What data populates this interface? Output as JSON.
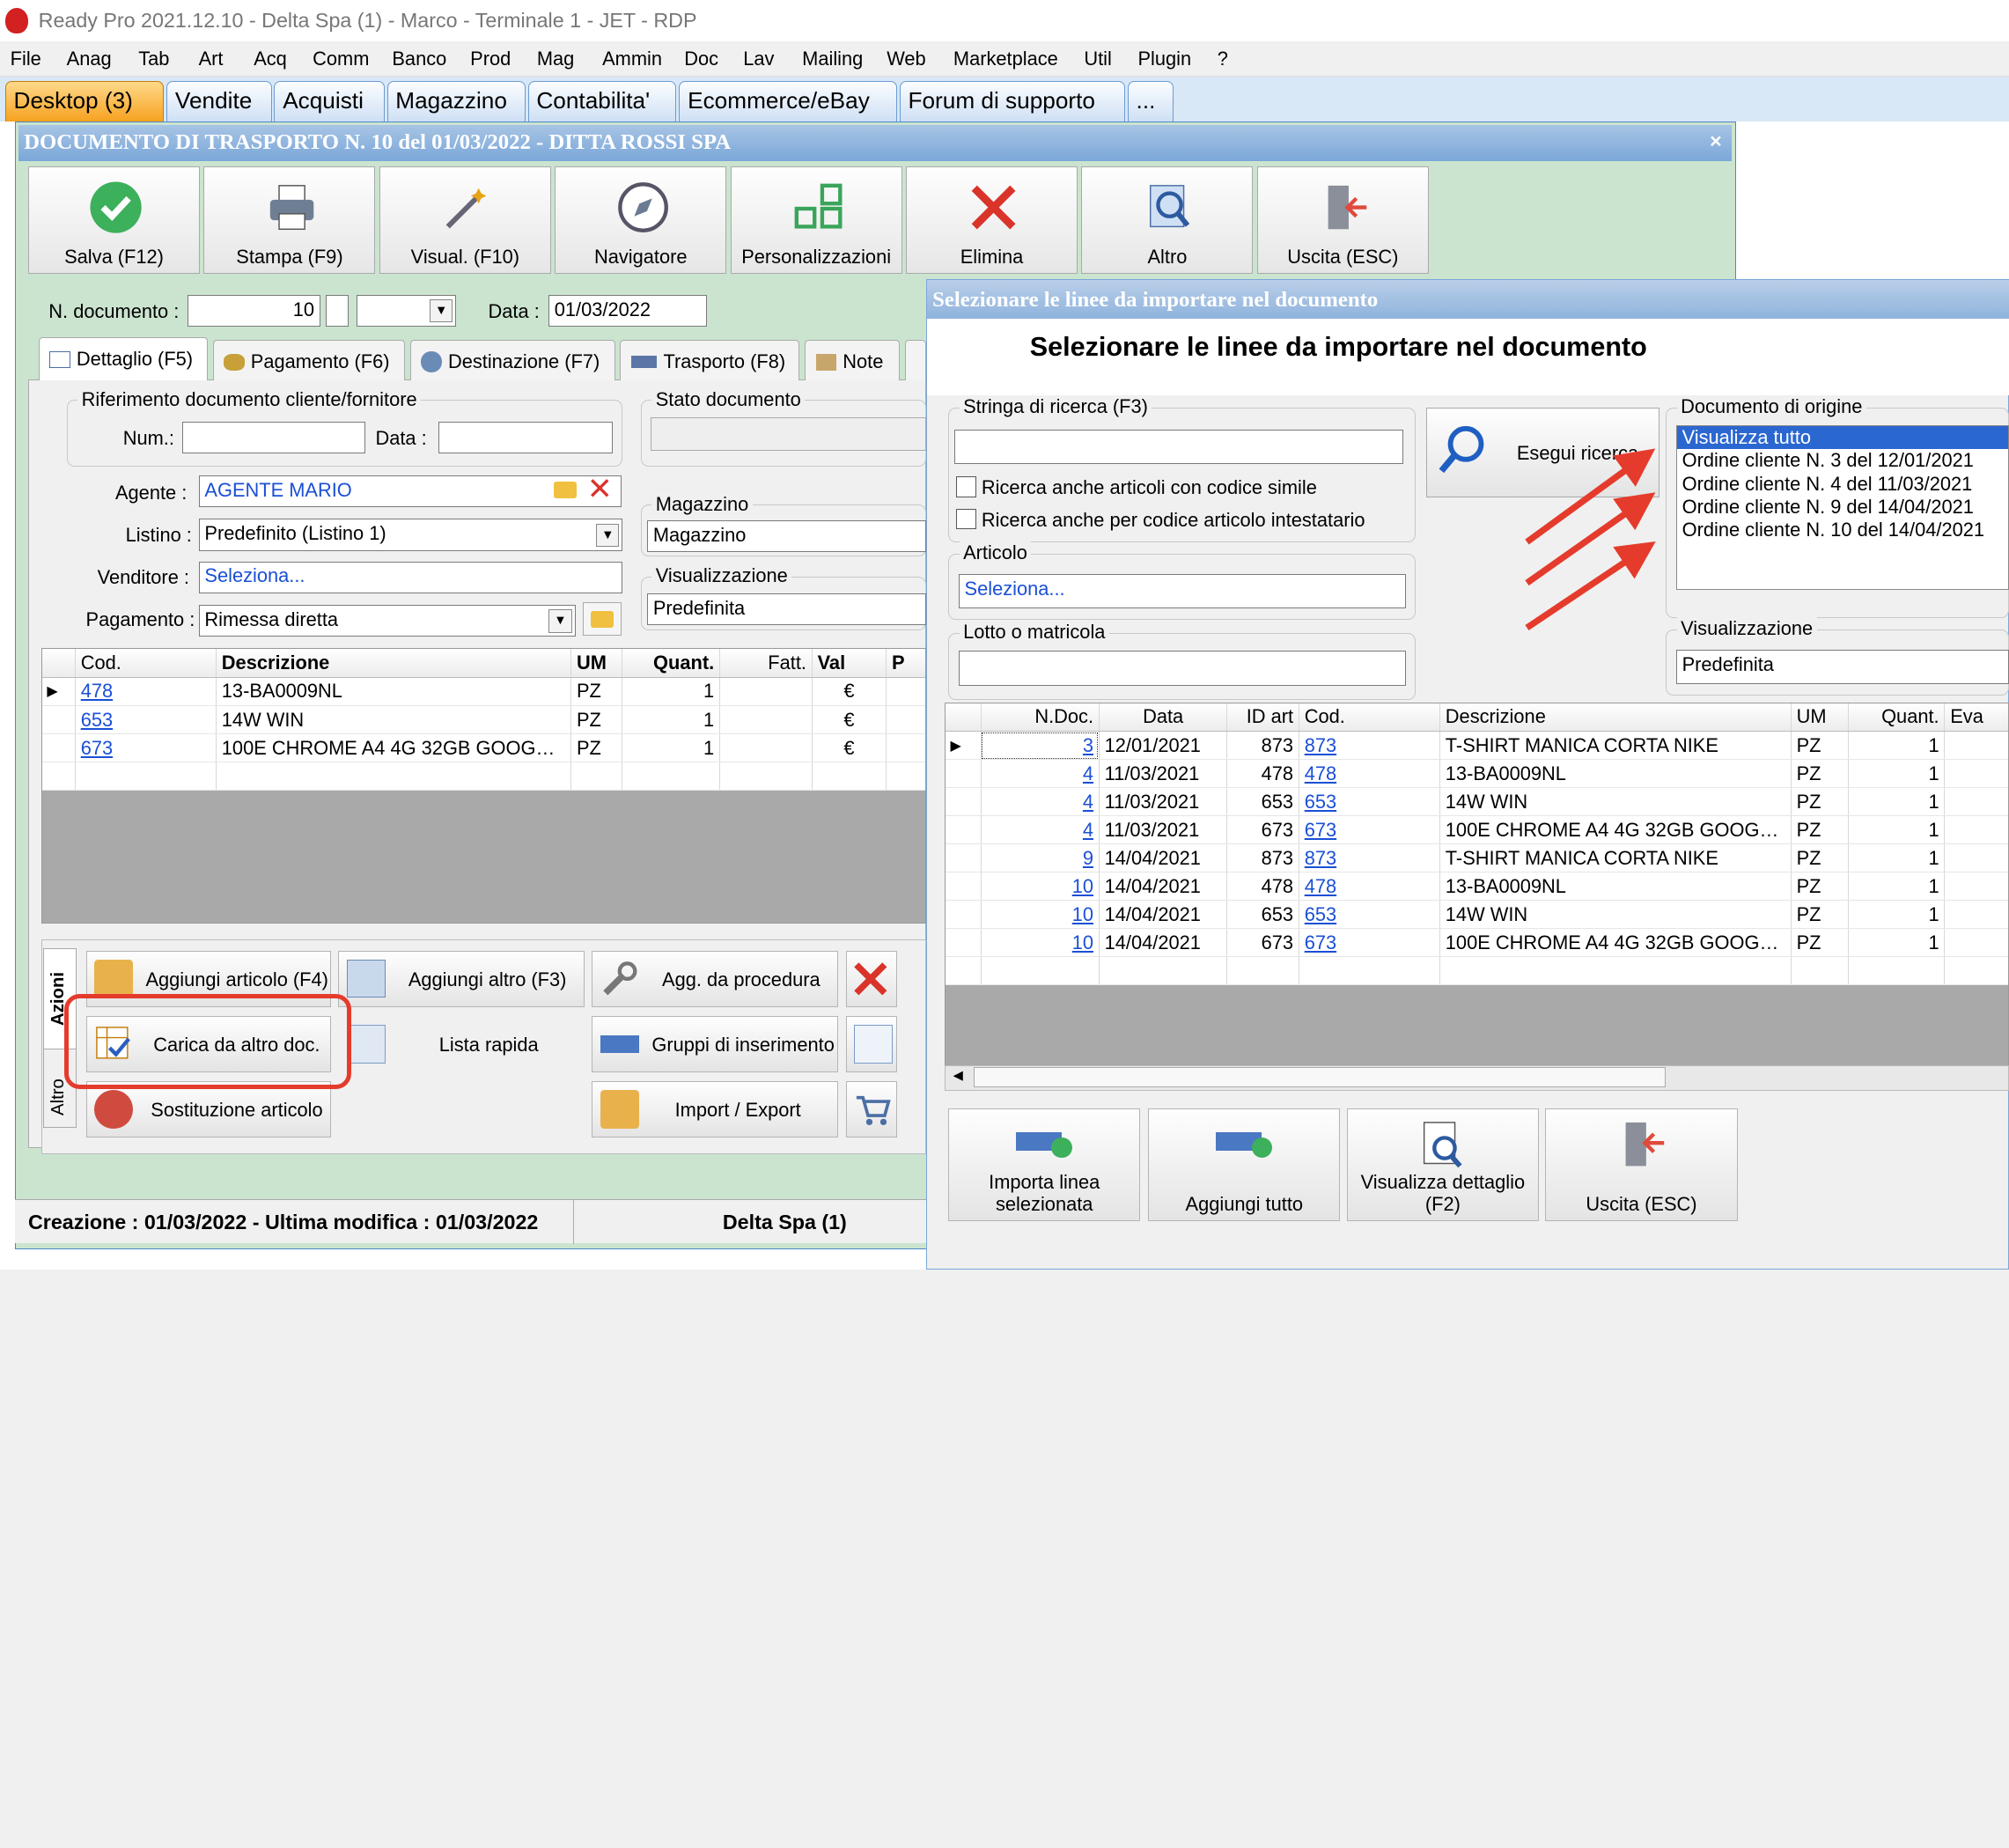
{
  "window": {
    "title": "Ready Pro 2021.12.10 - Delta Spa (1) - Marco - Terminale 1 - JET - RDP"
  },
  "menu": [
    "File",
    "Anag",
    "Tab",
    "Art",
    "Acq",
    "Comm",
    "Banco",
    "Prod",
    "Mag",
    "Ammin",
    "Doc",
    "Lav",
    "Mailing",
    "Web",
    "Marketplace",
    "Util",
    "Plugin",
    "?"
  ],
  "main_tabs": [
    "Desktop (3)",
    "Vendite",
    "Acquisti",
    "Magazzino",
    "Contabilita'",
    "Ecommerce/eBay",
    "Forum di supporto",
    "..."
  ],
  "document": {
    "title": "DOCUMENTO DI TRASPORTO N. 10 del 01/03/2022 - DITTA ROSSI SPA",
    "close": "×",
    "toolbar": [
      "Salva (F12)",
      "Stampa (F9)",
      "Visual. (F10)",
      "Navigatore",
      "Personalizzazioni",
      "Elimina",
      "Altro",
      "Uscita (ESC)"
    ],
    "num_label": "N. documento :",
    "num_value": "10",
    "date_label": "Data :",
    "date_value": "01/03/2022",
    "subtabs": [
      "Dettaglio (F5)",
      "Pagamento (F6)",
      "Destinazione (F7)",
      "Trasporto (F8)",
      "Note"
    ],
    "rif_group": "Riferimento documento cliente/fornitore",
    "rif_num": "Num.:",
    "rif_data": "Data :",
    "stato_group": "Stato documento",
    "agente_label": "Agente :",
    "agente_value": "AGENTE MARIO",
    "listino_label": "Listino :",
    "listino_value": "Predefinito (Listino 1)",
    "venditore_label": "Venditore :",
    "venditore_value": "Seleziona...",
    "pagamento_label": "Pagamento :",
    "pagamento_value": "Rimessa diretta",
    "magazzino_group": "Magazzino",
    "magazzino_value": "Magazzino",
    "visual_group": "Visualizzazione",
    "visual_value": "Predefinita",
    "grid_headers": [
      "Cod.",
      "Descrizione",
      "UM",
      "Quant.",
      "Fatt.",
      "Val",
      "P"
    ],
    "grid_rows": [
      [
        "478",
        "13-BA0009NL",
        "PZ",
        "1",
        "",
        "€"
      ],
      [
        "653",
        "14W WIN",
        "PZ",
        "1",
        "",
        "€"
      ],
      [
        "673",
        "100E CHROME A4 4G 32GB GOOGLEC...",
        "PZ",
        "1",
        "",
        "€"
      ]
    ],
    "side_tabs": [
      "Azioni",
      "Altro"
    ],
    "actions": [
      "Aggiungi articolo (F4)",
      "Aggiungi altro (F3)",
      "Agg. da procedura",
      "Carica da altro doc.",
      "Lista rapida",
      "Gruppi di inserimento",
      "Sostituzione articolo",
      "Import / Export"
    ],
    "status_left": "Creazione : 01/03/2022 - Ultima modifica : 01/03/2022",
    "status_right": "Delta Spa (1)"
  },
  "dialog": {
    "title": "Selezionare le linee da importare nel documento",
    "heading": "Selezionare le linee da importare nel documento",
    "search_group": "Stringa di ricerca (F3)",
    "search_value": "",
    "search_button": "Esegui ricerca",
    "check1": "Ricerca anche articoli con codice simile",
    "check2": "Ricerca anche per codice articolo intestatario",
    "articolo_group": "Articolo",
    "articolo_value": "Seleziona...",
    "lotto_group": "Lotto o matricola",
    "origin_group": "Documento di origine",
    "origin_items": [
      "Visualizza tutto",
      "Ordine cliente N. 3 del 12/01/2021",
      "Ordine cliente N. 4 del 11/03/2021",
      "Ordine cliente N. 9 del 14/04/2021",
      "Ordine cliente N. 10 del 14/04/2021"
    ],
    "visual_group": "Visualizzazione",
    "visual_value": "Predefinita",
    "grid_headers": [
      "N.Doc.",
      "Data",
      "ID art",
      "Cod.",
      "Descrizione",
      "UM",
      "Quant.",
      "Eva"
    ],
    "grid_rows": [
      [
        "3",
        "12/01/2021",
        "873",
        "873",
        "T-SHIRT MANICA CORTA NIKE",
        "PZ",
        "1"
      ],
      [
        "4",
        "11/03/2021",
        "478",
        "478",
        "13-BA0009NL",
        "PZ",
        "1"
      ],
      [
        "4",
        "11/03/2021",
        "653",
        "653",
        "14W WIN",
        "PZ",
        "1"
      ],
      [
        "4",
        "11/03/2021",
        "673",
        "673",
        "100E CHROME A4 4G 32GB GOOGLEC...",
        "PZ",
        "1"
      ],
      [
        "9",
        "14/04/2021",
        "873",
        "873",
        "T-SHIRT MANICA CORTA NIKE",
        "PZ",
        "1"
      ],
      [
        "10",
        "14/04/2021",
        "478",
        "478",
        "13-BA0009NL",
        "PZ",
        "1"
      ],
      [
        "10",
        "14/04/2021",
        "653",
        "653",
        "14W WIN",
        "PZ",
        "1"
      ],
      [
        "10",
        "14/04/2021",
        "673",
        "673",
        "100E CHROME A4 4G 32GB GOOGLEC...",
        "PZ",
        "1"
      ]
    ],
    "buttons": [
      "Importa linea selezionata",
      "Aggiungi tutto",
      "Visualizza dettaglio (F2)",
      "Uscita (ESC)"
    ]
  },
  "colors": {
    "highlight_red": "#e53b2c",
    "selection_blue": "#2b67d1",
    "accent_green": "#cbe4cf",
    "tab_orange": "#f6a21f"
  }
}
